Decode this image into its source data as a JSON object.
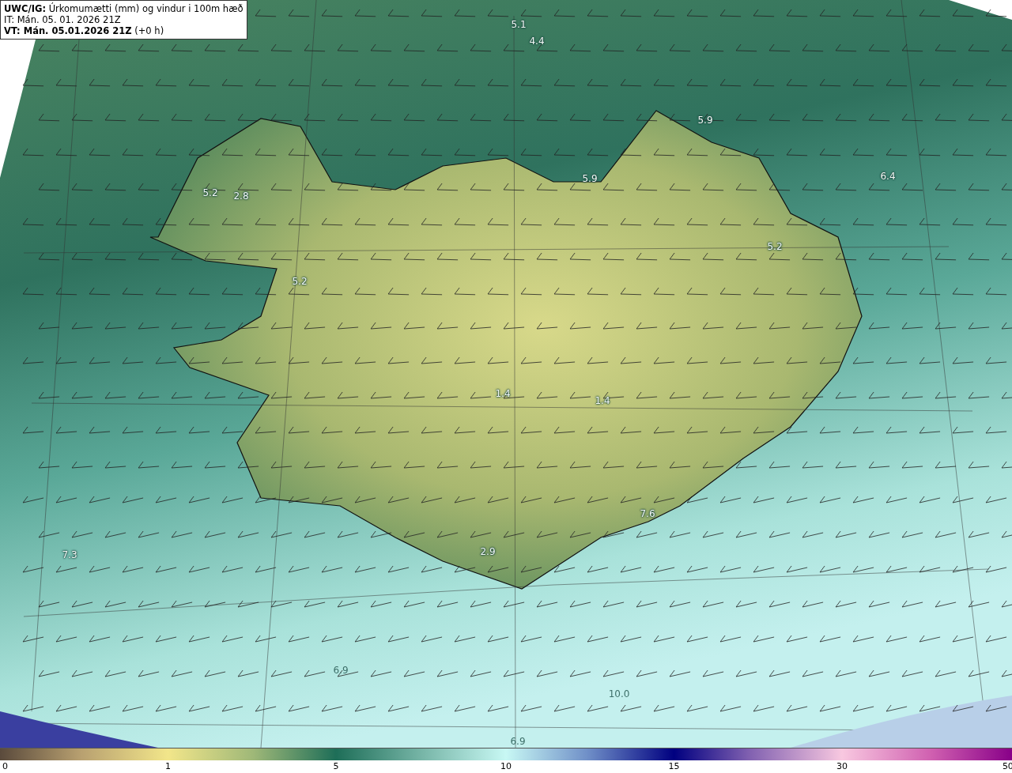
{
  "title_box": {
    "lines": [
      "**UWC/IG:** Úrkomumætti (mm) og vindur i 100m hæð",
      "IT: Mán. 05. 01. 2026 21Z",
      "**VT: Mán. 05.01.2026 21Z** (+0 h)"
    ]
  },
  "map": {
    "value_labels": [
      "5.1",
      "4.4",
      "5.9",
      "5.9",
      "6.4",
      "5.2",
      "2.8",
      "5.2",
      "5.2",
      "1.4",
      "1.4",
      "7.6",
      "2.9",
      "7.3",
      "6.9",
      "10.0",
      "6.9"
    ]
  },
  "colorbar": {
    "ticks": [
      "0",
      "1",
      "5",
      "10",
      "15",
      "30",
      "50"
    ]
  }
}
